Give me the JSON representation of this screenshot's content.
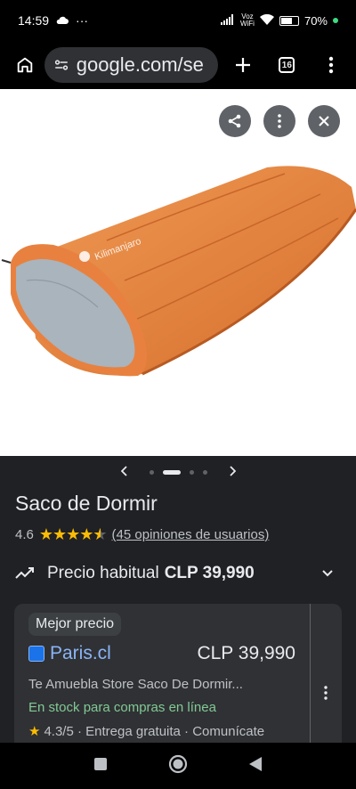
{
  "status": {
    "time": "14:59",
    "carrier_top": "Voz",
    "carrier_bottom": "WiFi",
    "battery": "70%",
    "battery_level": 0.7
  },
  "browser": {
    "url": "google.com/se",
    "tab_count": "16"
  },
  "product": {
    "title": "Saco de Dormir",
    "rating": "4.6",
    "rating_value": 4.6,
    "reviews": "(45 opiniones de usuarios)",
    "price_label": "Precio habitual",
    "price_value": "CLP 39,990"
  },
  "offer": {
    "badge": "Mejor precio",
    "store": "Paris.cl",
    "price": "CLP 39,990",
    "description": "Te Amuebla Store Saco De Dormir...",
    "stock": "En stock para compras en línea",
    "store_rating": "4.3/5 · Entrega gratuita · Comunícate"
  },
  "image": {
    "brand_text": "Kilimanjaro"
  },
  "colors": {
    "accent_link": "#8ab4f8",
    "stock_green": "#81c995",
    "star": "#fbbc04",
    "bag_orange": "#e8813f",
    "bag_lining": "#a9b4bc"
  }
}
